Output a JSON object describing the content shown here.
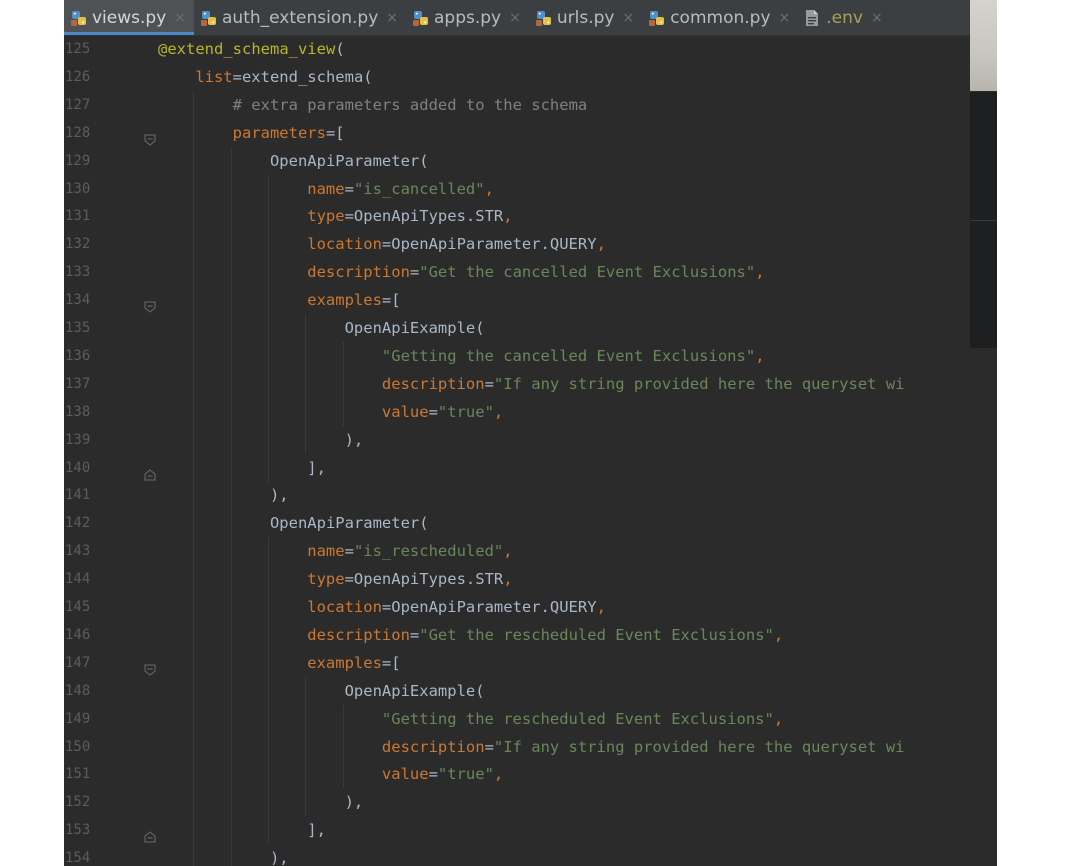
{
  "tabs": [
    {
      "label": "views.py",
      "icon": "python-file-icon",
      "active": true
    },
    {
      "label": "auth_extension.py",
      "icon": "python-file-icon",
      "active": false
    },
    {
      "label": "apps.py",
      "icon": "python-file-icon",
      "active": false
    },
    {
      "label": "urls.py",
      "icon": "python-file-icon",
      "active": false
    },
    {
      "label": "common.py",
      "icon": "python-file-icon",
      "active": false
    },
    {
      "label": ".env",
      "icon": "text-file-icon",
      "active": false
    }
  ],
  "tab_close_glyph": "×",
  "colors": {
    "editor_bg": "#2b2b2b",
    "tabbar_bg": "#3c3f41",
    "active_tab_underline": "#4a88c7",
    "keyword": "#cc7832",
    "string": "#6a8759",
    "comment": "#808080",
    "decorator": "#bbb529",
    "text": "#a9b7c6",
    "line_number": "#5a5d5f"
  },
  "lines": [
    {
      "n": "125",
      "indent": 0,
      "fold": "",
      "tokens": [
        [
          "dec",
          "@extend_schema_view"
        ],
        [
          "txt",
          "("
        ]
      ]
    },
    {
      "n": "126",
      "indent": 1,
      "fold": "",
      "tokens": [
        [
          "kw",
          "list"
        ],
        [
          "txt",
          "=extend_schema("
        ]
      ]
    },
    {
      "n": "127",
      "indent": 2,
      "fold": "",
      "tokens": [
        [
          "cmt",
          "# extra parameters added to the schema"
        ]
      ]
    },
    {
      "n": "128",
      "indent": 2,
      "fold": "open",
      "tokens": [
        [
          "kw",
          "parameters"
        ],
        [
          "txt",
          "=["
        ]
      ]
    },
    {
      "n": "129",
      "indent": 3,
      "fold": "",
      "tokens": [
        [
          "txt",
          "OpenApiParameter("
        ]
      ]
    },
    {
      "n": "130",
      "indent": 4,
      "fold": "",
      "tokens": [
        [
          "kw",
          "name"
        ],
        [
          "txt",
          "="
        ],
        [
          "str",
          "\"is_cancelled\""
        ],
        [
          "punc",
          ","
        ]
      ]
    },
    {
      "n": "131",
      "indent": 4,
      "fold": "",
      "tokens": [
        [
          "kw",
          "type"
        ],
        [
          "txt",
          "=OpenApiTypes.STR"
        ],
        [
          "punc",
          ","
        ]
      ]
    },
    {
      "n": "132",
      "indent": 4,
      "fold": "",
      "tokens": [
        [
          "kw",
          "location"
        ],
        [
          "txt",
          "=OpenApiParameter.QUERY"
        ],
        [
          "punc",
          ","
        ]
      ]
    },
    {
      "n": "133",
      "indent": 4,
      "fold": "",
      "tokens": [
        [
          "kw",
          "description"
        ],
        [
          "txt",
          "="
        ],
        [
          "str",
          "\"Get the cancelled Event Exclusions\""
        ],
        [
          "punc",
          ","
        ]
      ]
    },
    {
      "n": "134",
      "indent": 4,
      "fold": "open",
      "tokens": [
        [
          "kw",
          "examples"
        ],
        [
          "txt",
          "=["
        ]
      ]
    },
    {
      "n": "135",
      "indent": 5,
      "fold": "",
      "tokens": [
        [
          "txt",
          "OpenApiExample("
        ]
      ]
    },
    {
      "n": "136",
      "indent": 6,
      "fold": "",
      "tokens": [
        [
          "str",
          "\"Getting the cancelled Event Exclusions\""
        ],
        [
          "punc",
          ","
        ]
      ]
    },
    {
      "n": "137",
      "indent": 6,
      "fold": "",
      "tokens": [
        [
          "kw",
          "description"
        ],
        [
          "txt",
          "="
        ],
        [
          "str",
          "\"If any string provided here the queryset wi"
        ]
      ]
    },
    {
      "n": "138",
      "indent": 6,
      "fold": "",
      "tokens": [
        [
          "kw",
          "value"
        ],
        [
          "txt",
          "="
        ],
        [
          "str",
          "\"true\""
        ],
        [
          "punc",
          ","
        ]
      ]
    },
    {
      "n": "139",
      "indent": 5,
      "fold": "",
      "tokens": [
        [
          "txt",
          "),"
        ]
      ]
    },
    {
      "n": "140",
      "indent": 4,
      "fold": "close",
      "tokens": [
        [
          "txt",
          "],"
        ]
      ]
    },
    {
      "n": "141",
      "indent": 3,
      "fold": "",
      "tokens": [
        [
          "txt",
          "),"
        ]
      ]
    },
    {
      "n": "142",
      "indent": 3,
      "fold": "",
      "tokens": [
        [
          "txt",
          "OpenApiParameter("
        ]
      ]
    },
    {
      "n": "143",
      "indent": 4,
      "fold": "",
      "tokens": [
        [
          "kw",
          "name"
        ],
        [
          "txt",
          "="
        ],
        [
          "str",
          "\"is_rescheduled\""
        ],
        [
          "punc",
          ","
        ]
      ]
    },
    {
      "n": "144",
      "indent": 4,
      "fold": "",
      "tokens": [
        [
          "kw",
          "type"
        ],
        [
          "txt",
          "=OpenApiTypes.STR"
        ],
        [
          "punc",
          ","
        ]
      ]
    },
    {
      "n": "145",
      "indent": 4,
      "fold": "",
      "tokens": [
        [
          "kw",
          "location"
        ],
        [
          "txt",
          "=OpenApiParameter.QUERY"
        ],
        [
          "punc",
          ","
        ]
      ]
    },
    {
      "n": "146",
      "indent": 4,
      "fold": "",
      "tokens": [
        [
          "kw",
          "description"
        ],
        [
          "txt",
          "="
        ],
        [
          "str",
          "\"Get the rescheduled Event Exclusions\""
        ],
        [
          "punc",
          ","
        ]
      ]
    },
    {
      "n": "147",
      "indent": 4,
      "fold": "open",
      "tokens": [
        [
          "kw",
          "examples"
        ],
        [
          "txt",
          "=["
        ]
      ]
    },
    {
      "n": "148",
      "indent": 5,
      "fold": "",
      "tokens": [
        [
          "txt",
          "OpenApiExample("
        ]
      ]
    },
    {
      "n": "149",
      "indent": 6,
      "fold": "",
      "tokens": [
        [
          "str",
          "\"Getting the rescheduled Event Exclusions\""
        ],
        [
          "punc",
          ","
        ]
      ]
    },
    {
      "n": "150",
      "indent": 6,
      "fold": "",
      "tokens": [
        [
          "kw",
          "description"
        ],
        [
          "txt",
          "="
        ],
        [
          "str",
          "\"If any string provided here the queryset wi"
        ]
      ]
    },
    {
      "n": "151",
      "indent": 6,
      "fold": "",
      "tokens": [
        [
          "kw",
          "value"
        ],
        [
          "txt",
          "="
        ],
        [
          "str",
          "\"true\""
        ],
        [
          "punc",
          ","
        ]
      ]
    },
    {
      "n": "152",
      "indent": 5,
      "fold": "",
      "tokens": [
        [
          "txt",
          "),"
        ]
      ]
    },
    {
      "n": "153",
      "indent": 4,
      "fold": "close",
      "tokens": [
        [
          "txt",
          "],"
        ]
      ]
    },
    {
      "n": "154",
      "indent": 3,
      "fold": "",
      "tokens": [
        [
          "txt",
          "),"
        ]
      ]
    }
  ]
}
